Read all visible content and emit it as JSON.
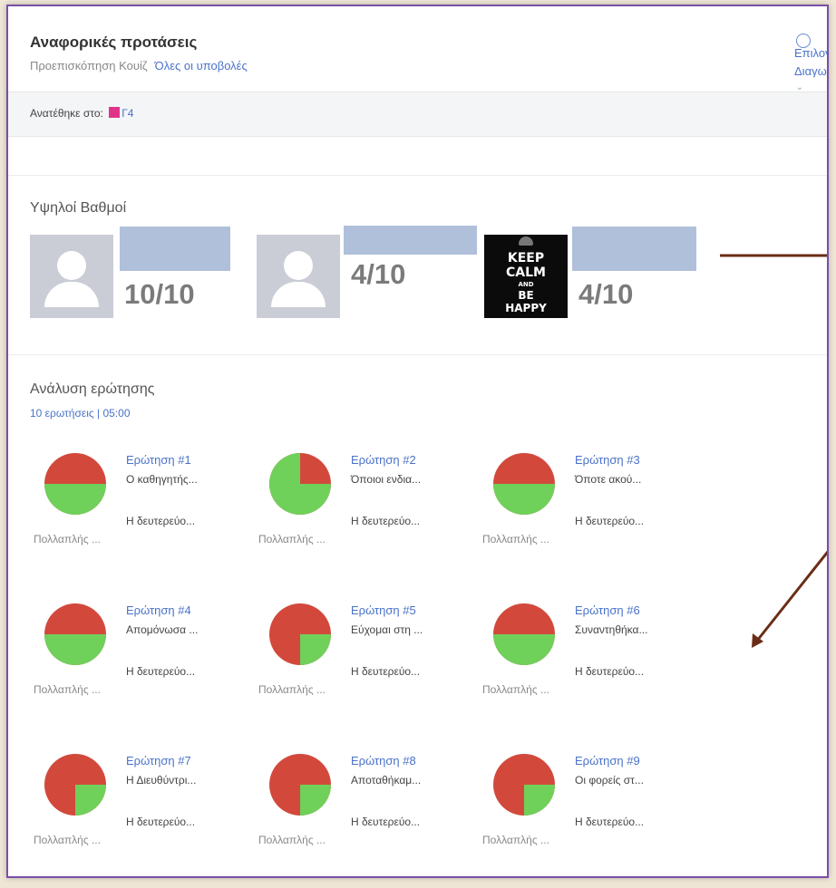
{
  "header": {
    "title": "Αναφορικές προτάσεις",
    "preview_label": "Προεπισκόπηση Κουίζ",
    "all_submissions_label": "Όλες οι υποβολές",
    "right_links": [
      "Επιλογ",
      "Διαγωγ"
    ]
  },
  "assigned": {
    "label": "Ανατέθηκε στο:",
    "class_name": "Γ4",
    "class_color": "#e0348a"
  },
  "top_scores": {
    "title": "Υψηλοί Βαθμοί",
    "students": [
      {
        "score": "10/10",
        "avatar": "default-avatar-icon"
      },
      {
        "score": "4/10",
        "avatar": "default-avatar-icon"
      },
      {
        "score": "4/10",
        "avatar": "keep-calm-image"
      }
    ],
    "keep_calm": [
      "KEEP",
      "CALM",
      "AND",
      "BE",
      "HAPPY"
    ]
  },
  "analysis": {
    "title": "Ανάλυση ερώτησης",
    "meta": "10 ερωτήσεις | 05:00",
    "questions": [
      {
        "title": "Ερώτηση #1",
        "text": "Ο καθηγητής...",
        "answer": "Η δευτερεύο...",
        "kind": "Πολλαπλής ...",
        "correct_fraction": 0.5
      },
      {
        "title": "Ερώτηση #2",
        "text": "Όποιοι ενδια...",
        "answer": "Η δευτερεύο...",
        "kind": "Πολλαπλής ...",
        "correct_fraction": 0.75
      },
      {
        "title": "Ερώτηση #3",
        "text": "Όποτε ακού...",
        "answer": "Η δευτερεύο...",
        "kind": "Πολλαπλής ...",
        "correct_fraction": 0.5
      },
      {
        "title": "Ερώτηση #4",
        "text": "Απομόνωσα ...",
        "answer": "Η δευτερεύο...",
        "kind": "Πολλαπλής ...",
        "correct_fraction": 0.5
      },
      {
        "title": "Ερώτηση #5",
        "text": "Εύχομαι στη ...",
        "answer": "Η δευτερεύο...",
        "kind": "Πολλαπλής ...",
        "correct_fraction": 0.25
      },
      {
        "title": "Ερώτηση #6",
        "text": "Συναντηθήκα...",
        "answer": "Η δευτερεύο...",
        "kind": "Πολλαπλής ...",
        "correct_fraction": 0.5
      },
      {
        "title": "Ερώτηση #7",
        "text": "Η Διευθύντρι...",
        "answer": "Η δευτερεύο...",
        "kind": "Πολλαπλής ...",
        "correct_fraction": 0.25
      },
      {
        "title": "Ερώτηση #8",
        "text": "Αποταθήκαμ...",
        "answer": "Η δευτερεύο...",
        "kind": "Πολλαπλής ...",
        "correct_fraction": 0.25
      },
      {
        "title": "Ερώτηση #9",
        "text": "Οι φορείς στ...",
        "answer": "Η δευτερεύο...",
        "kind": "Πολλαπλής ...",
        "correct_fraction": 0.25
      }
    ]
  },
  "colors": {
    "correct": "#6fd05a",
    "incorrect": "#d2493c",
    "link": "#4a72c9",
    "annotation_arrow": "#6b2d17"
  }
}
